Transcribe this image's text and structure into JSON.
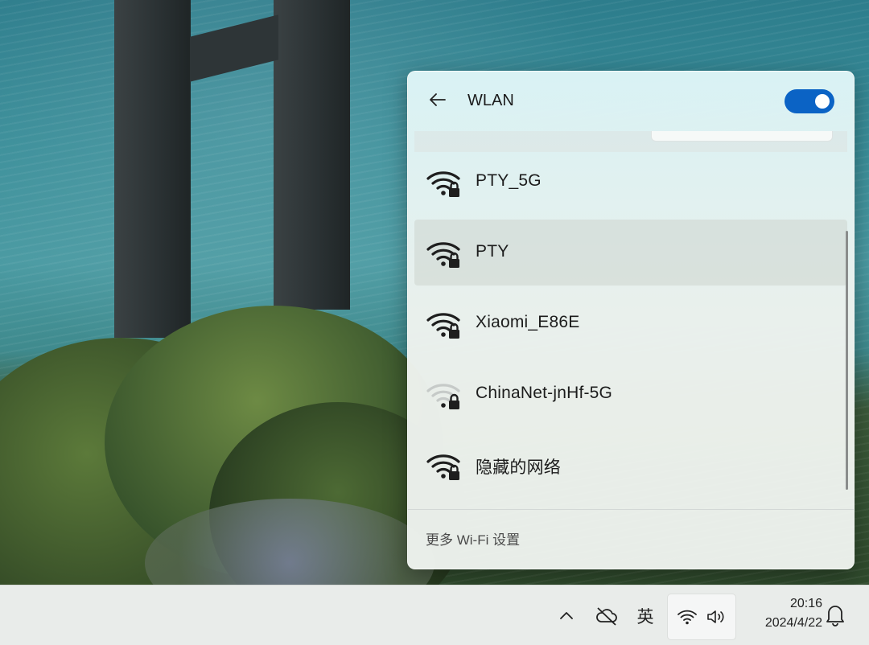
{
  "wlan_panel": {
    "title": "WLAN",
    "toggle_on": true,
    "networks": [
      {
        "name": "PTY_5G",
        "signal": "strong",
        "secured": true
      },
      {
        "name": "PTY",
        "signal": "strong",
        "secured": true,
        "hovered": true
      },
      {
        "name": "Xiaomi_E86E",
        "signal": "strong",
        "secured": true
      },
      {
        "name": "ChinaNet-jnHf-5G",
        "signal": "weak",
        "secured": true
      },
      {
        "name": "隐藏的网络",
        "signal": "strong",
        "secured": true
      }
    ],
    "more_settings": "更多 Wi-Fi 设置"
  },
  "taskbar": {
    "ime_label": "英",
    "time": "20:16",
    "date": "2024/4/22"
  },
  "icons": {
    "back": "back-arrow-icon",
    "wifi": "wifi-locked-icon",
    "chevron": "chevron-up-icon",
    "cloud": "cloud-offline-icon",
    "speaker": "speaker-icon",
    "notification": "notification-icon"
  },
  "colors": {
    "accent": "#0b63c5",
    "panel_bg": "#eef3ee",
    "taskbar_bg": "#e9ecea"
  }
}
